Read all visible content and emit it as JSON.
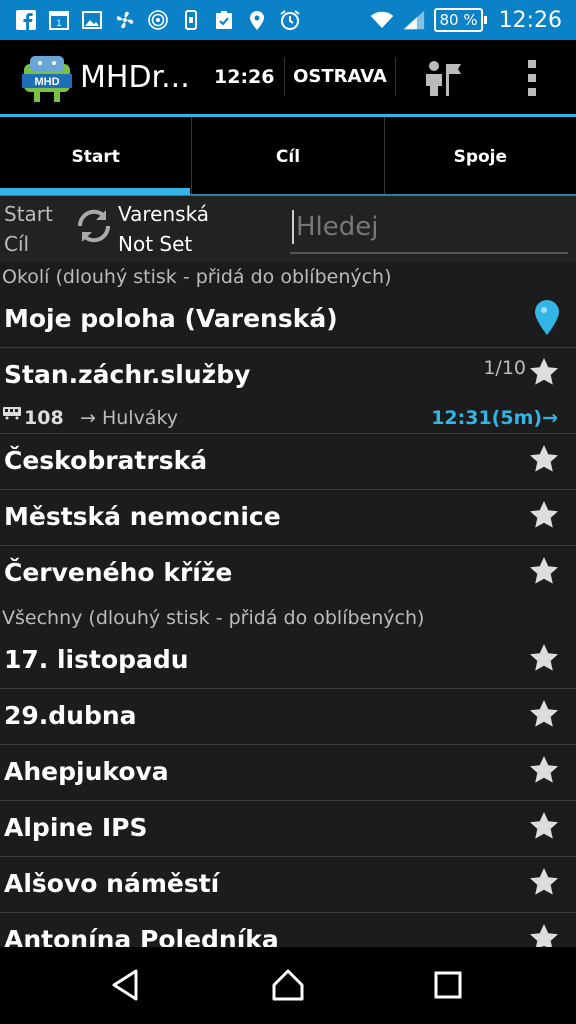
{
  "status_bar": {
    "battery": "80 %",
    "time": "12:26",
    "notification_icons": [
      "facebook-icon",
      "calendar-icon",
      "image-icon",
      "fan-icon",
      "hotspot-icon",
      "phone-icon",
      "clipboard-check-icon",
      "location-icon",
      "alarm-icon"
    ]
  },
  "action_bar": {
    "app_name": "MHDr...",
    "time": "12:26",
    "city": "OSTRAVA",
    "logo_text": "MHD"
  },
  "tabs": [
    {
      "label": "Start",
      "active": true
    },
    {
      "label": "Cíl",
      "active": false
    },
    {
      "label": "Spoje",
      "active": false
    }
  ],
  "route": {
    "start_label": "Start",
    "start_value": "Varenská",
    "dest_label": "Cíl",
    "dest_value": "Not Set",
    "search_placeholder": "Hledej"
  },
  "nearby": {
    "header": "Okolí (dlouhý stisk - přidá do oblíbených)",
    "my_location": "Moje poloha (Varenská)",
    "stops": [
      {
        "name": "Stan.záchr.služby",
        "pager": "1/10",
        "line": "108",
        "destination": "→ Hulváky",
        "departure": "12:31(5m)→"
      },
      {
        "name": "Českobratrská"
      },
      {
        "name": "Městská nemocnice"
      },
      {
        "name": "Červeného kříže"
      }
    ]
  },
  "all": {
    "header": "Všechny (dlouhý stisk - přidá do oblíbených)",
    "stops": [
      "17. listopadu",
      "29.dubna",
      "Ahepjukova",
      "Alpine IPS",
      "Alšovo náměstí",
      "Antonína Poledníka"
    ]
  },
  "colors": {
    "status_bar": "#0b82c8",
    "accent": "#33b5e5",
    "background": "#1c1c1c"
  }
}
